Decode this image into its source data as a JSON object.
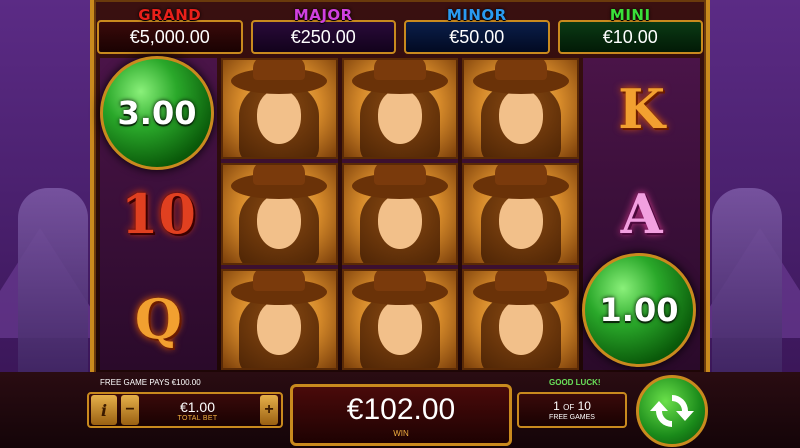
{
  "jackpots": [
    {
      "label": "GRAND",
      "value": "€5,000.00",
      "color": "#e8201a"
    },
    {
      "label": "MAJOR",
      "value": "€250.00",
      "color": "#d040e0"
    },
    {
      "label": "MINOR",
      "value": "€50.00",
      "color": "#2a9af0"
    },
    {
      "label": "MINI",
      "value": "€10.00",
      "color": "#3ae03a"
    }
  ],
  "reels": {
    "reel1": [
      "orb",
      "10",
      "Q"
    ],
    "reel2": [
      "woman",
      "woman",
      "woman"
    ],
    "reel3": [
      "woman",
      "woman",
      "woman"
    ],
    "reel4": [
      "woman",
      "woman",
      "woman"
    ],
    "reel5": [
      "K",
      "A",
      "orb"
    ]
  },
  "orbs": {
    "top_left": "3.00",
    "bottom_right": "1.00"
  },
  "bottom": {
    "free_game_pays": "FREE GAME PAYS €100.00",
    "good_luck": "GOOD LUCK!",
    "info_icon": "i",
    "minus": "−",
    "plus": "+",
    "total_bet_value": "€1.00",
    "total_bet_label": "TOTAL BET",
    "win_value": "€102.00",
    "win_label": "WIN",
    "free_games_current": "1",
    "free_games_of": "OF",
    "free_games_total": "10",
    "free_games_label": "FREE GAMES",
    "spin_icon": "spin-arrows-icon"
  }
}
